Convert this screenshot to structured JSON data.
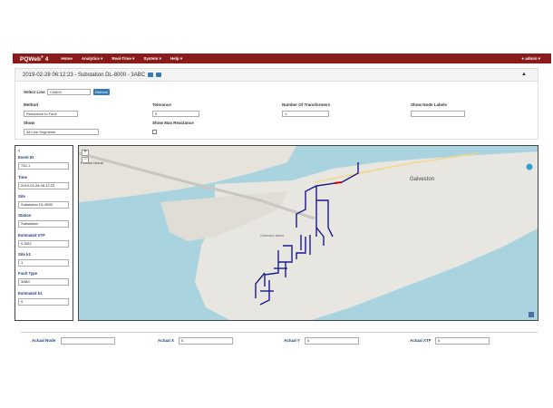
{
  "nav": {
    "brand": "PQWeb",
    "brand_sup": "®",
    "brand_version": " 4",
    "items": [
      {
        "label": "Home"
      },
      {
        "label": "Analytics ▾"
      },
      {
        "label": "Real-Time ▾"
      },
      {
        "label": "System ▾"
      },
      {
        "label": "Help ▾"
      }
    ],
    "user": "admin ▾"
  },
  "panel": {
    "title": "2019-02-28 06:12:23 - Substation DL-8000 - 3ABC",
    "select_line_label": "Select Line",
    "select_line_value": "CAB04",
    "refresh_label": "Refresh",
    "method_label": "Method",
    "method_value": "Reactance to Fault",
    "tolerance_label": "Tolerance",
    "tolerance_value": "5",
    "transformers_label": "Number Of Transformers",
    "transformers_value": "1",
    "node_labels_label": "Show Node Labels",
    "show_label": "Show",
    "show_value": "All Line Segments",
    "max_reactance_label": "Show Max Reactance"
  },
  "event": {
    "fields": [
      {
        "label": "Event ID",
        "value": "742-1"
      },
      {
        "label": "Time",
        "value": "2019-02-28 06:12:23"
      },
      {
        "label": "Site",
        "value": "Substation DL-8000"
      },
      {
        "label": "Station",
        "value": "Substation"
      },
      {
        "label": "Estimated XTF",
        "value": "0.2811"
      },
      {
        "label": "Site k1",
        "value": "1"
      },
      {
        "label": "Fault Type",
        "value": "3ABC"
      },
      {
        "label": "Estimated k1",
        "value": "0"
      }
    ]
  },
  "map": {
    "place_galveston": "Galveston",
    "place_pelican": "Pelican Island",
    "place_label_small": "Galveston Island",
    "zoom_in": "+",
    "zoom_out": "−",
    "colors": {
      "water": "#a9d3df",
      "land": "#e8e6e1",
      "line": "#1a1a8c",
      "fault": "#cc0000"
    }
  },
  "bottom": {
    "actual_node_label": "Actual Node",
    "actual_x_label": "Actual X",
    "actual_x_value": "0",
    "actual_y_label": "Actual Y",
    "actual_y_value": "0",
    "actual_xtf_label": "Actual XTF",
    "actual_xtf_value": "0"
  }
}
